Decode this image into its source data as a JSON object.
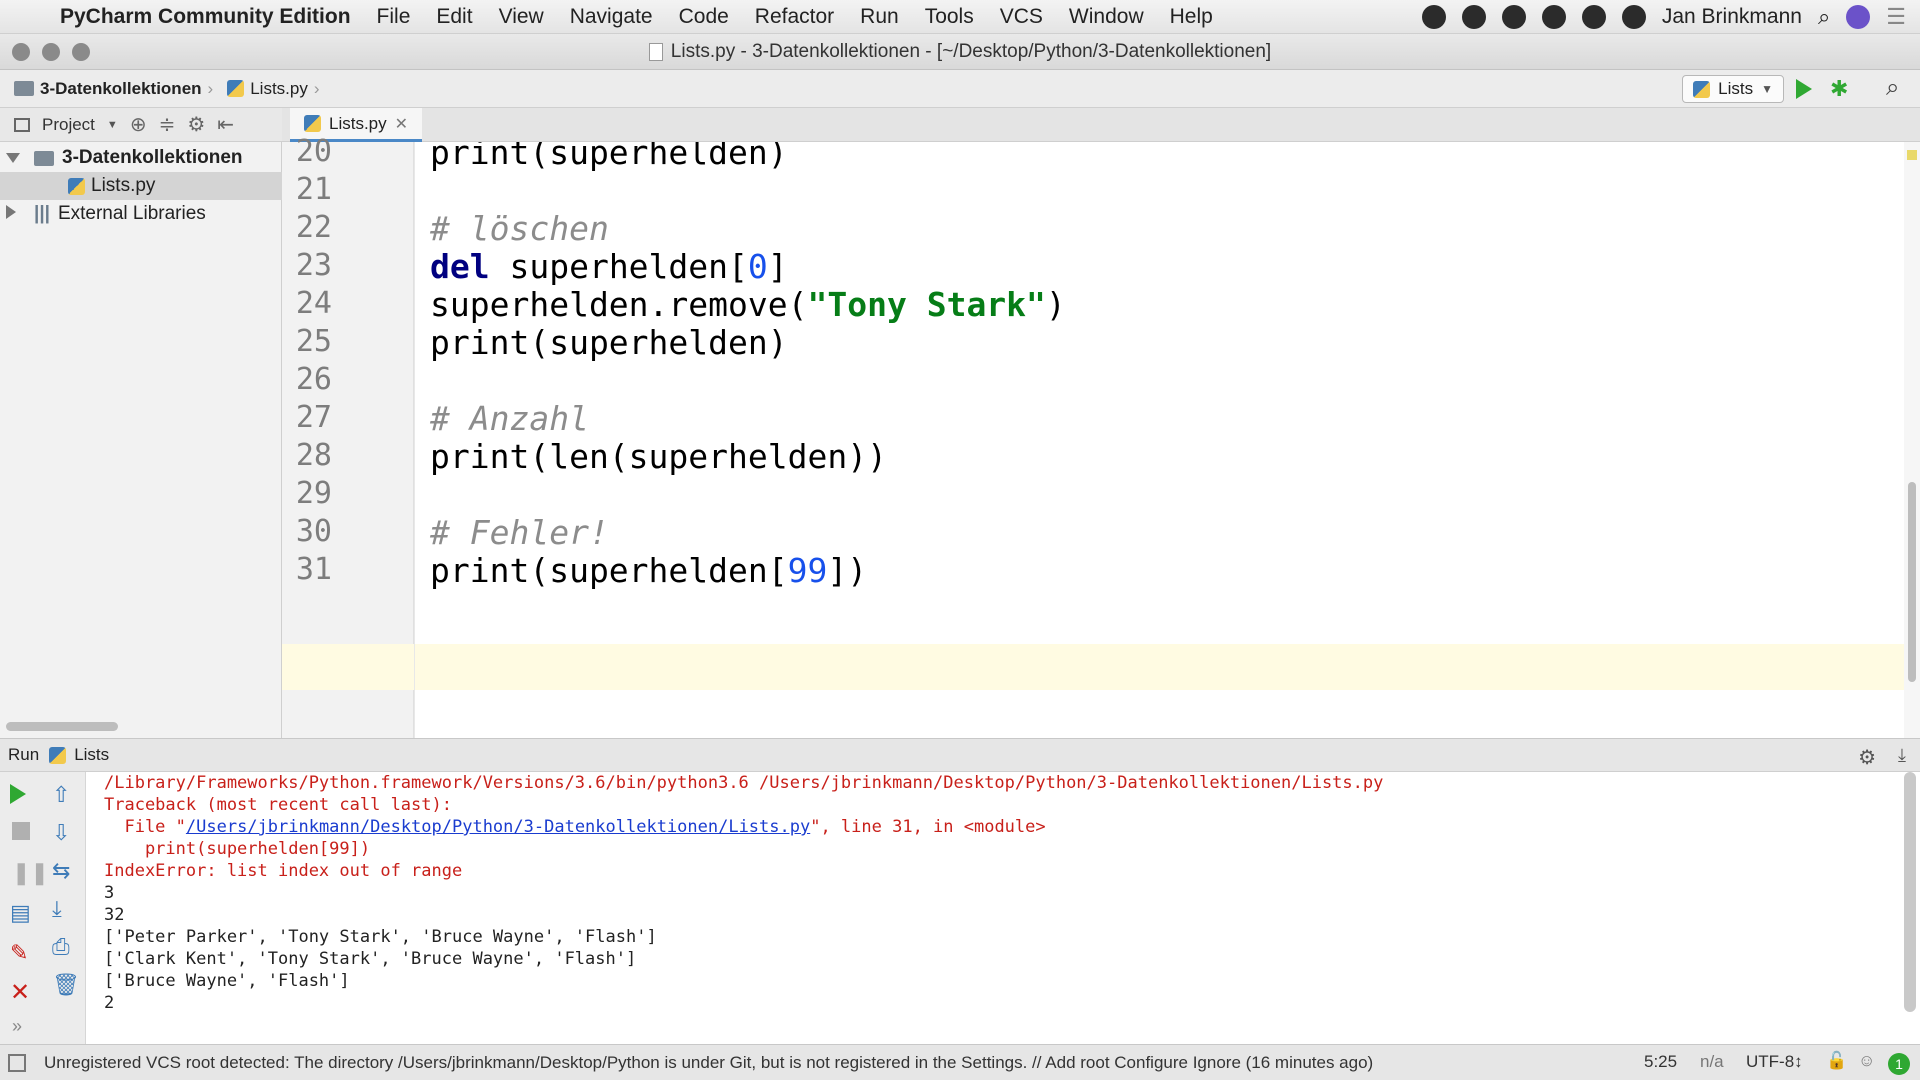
{
  "menubar": {
    "app_name": "PyCharm Community Edition",
    "items": [
      "File",
      "Edit",
      "View",
      "Navigate",
      "Code",
      "Refactor",
      "Run",
      "Tools",
      "VCS",
      "Window",
      "Help"
    ],
    "user": "Jan Brinkmann"
  },
  "window": {
    "title": "Lists.py - 3-Datenkollektionen - [~/Desktop/Python/3-Datenkollektionen]"
  },
  "navbar": {
    "project_crumb": "3-Datenkollektionen",
    "file_crumb": "Lists.py",
    "run_config": "Lists"
  },
  "project_panel": {
    "label": "Project",
    "root": "3-Datenkollektionen",
    "file": "Lists.py",
    "external": "External Libraries"
  },
  "editor": {
    "tab": "Lists.py",
    "lines": [
      {
        "num": "20",
        "text": "print(superhelden)"
      },
      {
        "num": "21",
        "text": ""
      },
      {
        "num": "22",
        "text": "# löschen"
      },
      {
        "num": "23",
        "text": "del superhelden[0]"
      },
      {
        "num": "24",
        "text": "superhelden.remove(\"Tony Stark\")"
      },
      {
        "num": "25",
        "text": "print(superhelden)"
      },
      {
        "num": "26",
        "text": ""
      },
      {
        "num": "27",
        "text": "# Anzahl"
      },
      {
        "num": "28",
        "text": "print(len(superhelden))"
      },
      {
        "num": "29",
        "text": ""
      },
      {
        "num": "30",
        "text": "# Fehler!"
      },
      {
        "num": "31",
        "text": "print(superhelden[99])"
      }
    ]
  },
  "run_panel": {
    "label": "Run",
    "config": "Lists",
    "output": [
      "/Library/Frameworks/Python.framework/Versions/3.6/bin/python3.6 /Users/jbrinkmann/Desktop/Python/3-Datenkollektionen/Lists.py",
      "Traceback (most recent call last):",
      "  File \"/Users/jbrinkmann/Desktop/Python/3-Datenkollektionen/Lists.py\", line 31, in <module>",
      "    print(superhelden[99])",
      "IndexError: list index out of range",
      "3",
      "32",
      "['Peter Parker', 'Tony Stark', 'Bruce Wayne', 'Flash']",
      "['Clark Kent', 'Tony Stark', 'Bruce Wayne', 'Flash']",
      "['Bruce Wayne', 'Flash']",
      "2"
    ],
    "file_link": "/Users/jbrinkmann/Desktop/Python/3-Datenkollektionen/Lists.py"
  },
  "statusbar": {
    "message": "Unregistered VCS root detected: The directory /Users/jbrinkmann/Desktop/Python is under Git, but is not registered in the Settings. // Add root  Configure  Ignore (16 minutes ago)",
    "position": "5:25",
    "na": "n/a",
    "encoding": "UTF-8↕",
    "counter": "1"
  },
  "colors": {
    "run_green": "#2fa832",
    "error_red": "#c8201a",
    "keyword_blue": "#000080",
    "string_green": "#067d17",
    "number_blue": "#1750eb",
    "current_line": "#fffbe2"
  }
}
